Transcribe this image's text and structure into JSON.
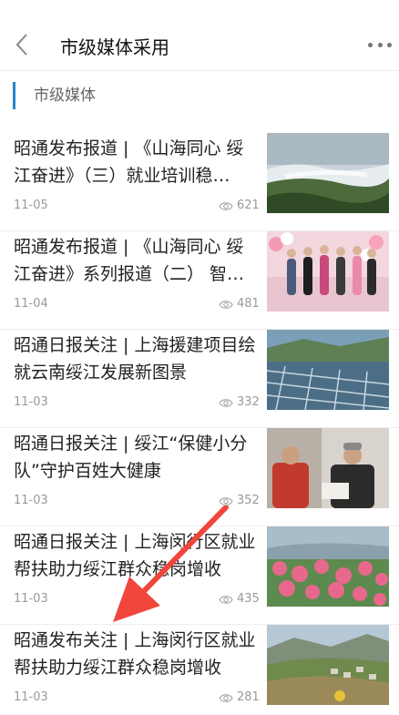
{
  "header": {
    "title": "市级媒体采用"
  },
  "section": {
    "title": "市级媒体"
  },
  "articles": [
    {
      "title": "昭通发布报道 | 《山海同心 绥江奋进》（三）就业培训稳…",
      "date": "11-05",
      "views": "621",
      "thumb": "misty-forest-hills"
    },
    {
      "title": "昭通发布报道 | 《山海同心 绥江奋进》系列报道（二） 智…",
      "date": "11-04",
      "views": "481",
      "thumb": "group-of-women-with-balloons"
    },
    {
      "title": "昭通日报关注 | 上海援建项目绘就云南绥江发展新图景",
      "date": "11-03",
      "views": "332",
      "thumb": "greenhouse-frames-valley"
    },
    {
      "title": "昭通日报关注 | 绥江“保健小分队”守护百姓大健康",
      "date": "11-03",
      "views": "352",
      "thumb": "doctor-visiting-elder"
    },
    {
      "title": "昭通日报关注 | 上海闵行区就业帮扶助力绥江群众稳岗增收",
      "date": "11-03",
      "views": "435",
      "thumb": "blossoming-trees-hillside"
    },
    {
      "title": "昭通发布关注 | 上海闵行区就业帮扶助力绥江群众稳岗增收",
      "date": "11-03",
      "views": "281",
      "thumb": "mountain-village-valley"
    }
  ],
  "colors": {
    "accent": "#2a85c7",
    "arrow": "#f0463c"
  }
}
